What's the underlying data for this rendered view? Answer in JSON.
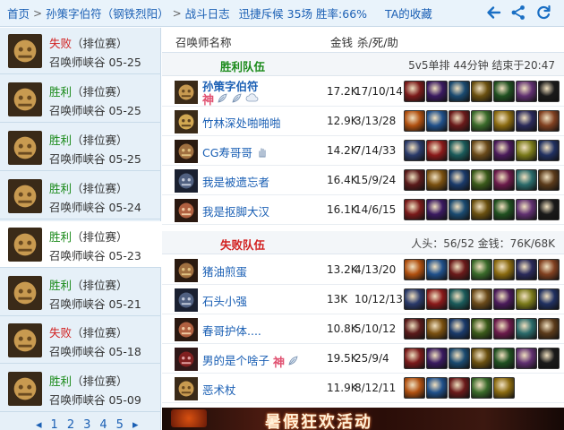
{
  "topbar": {
    "home": "首页",
    "sep": ">",
    "player": "孙策字伯符（钢铁烈阳）",
    "log": "战斗日志",
    "status": "迅捷斥候 35场 胜率:66%",
    "favorites": "TA的收藏"
  },
  "colors": {
    "win": "#1a8a1a",
    "lose": "#d22020",
    "link": "#1a5fb4",
    "sidebar_bg": "#e6f0f8"
  },
  "sidebar": {
    "matches": [
      {
        "result": "失败",
        "outcome": "lose",
        "type": "（排位赛）",
        "mode": "召唤师峡谷 05-25",
        "active": false
      },
      {
        "result": "胜利",
        "outcome": "win",
        "type": "（排位赛）",
        "mode": "召唤师峡谷 05-25",
        "active": false
      },
      {
        "result": "胜利",
        "outcome": "win",
        "type": "（排位赛）",
        "mode": "召唤师峡谷 05-25",
        "active": false
      },
      {
        "result": "胜利",
        "outcome": "win",
        "type": "（排位赛）",
        "mode": "召唤师峡谷 05-24",
        "active": false
      },
      {
        "result": "胜利",
        "outcome": "win",
        "type": "（排位赛）",
        "mode": "召唤师峡谷 05-23",
        "active": true
      },
      {
        "result": "胜利",
        "outcome": "win",
        "type": "（排位赛）",
        "mode": "召唤师峡谷 05-21",
        "active": false
      },
      {
        "result": "失败",
        "outcome": "lose",
        "type": "（排位赛）",
        "mode": "召唤师峡谷 05-18",
        "active": false
      },
      {
        "result": "胜利",
        "outcome": "win",
        "type": "（排位赛）",
        "mode": "召唤师峡谷 05-09",
        "active": false
      }
    ],
    "pager": {
      "prev": "◂",
      "pages": [
        "1",
        "2",
        "3",
        "4",
        "5"
      ],
      "next": "▸"
    }
  },
  "table": {
    "header": {
      "name": "召唤师名称",
      "gold": "金钱",
      "kda": "杀/死/助"
    },
    "win_team": {
      "label": "胜利队伍",
      "meta": "5v5单排 44分钟 结束于20:47",
      "players": [
        {
          "name": "孙策字伯符",
          "gold": "17.2K",
          "kda": "17/10/14",
          "badges": [
            "神",
            "feather",
            "feather",
            "cloud"
          ]
        },
        {
          "name": "竹林深处啪啪啪",
          "gold": "12.9K",
          "kda": "3/13/28",
          "badges": []
        },
        {
          "name": "CG寿哥哥",
          "gold": "14.2K",
          "kda": "7/14/33",
          "badges": [
            "hand"
          ]
        },
        {
          "name": "我是被遗忘者",
          "gold": "16.4K",
          "kda": "15/9/24",
          "badges": []
        },
        {
          "name": "我是抠脚大汉",
          "gold": "16.1K",
          "kda": "14/6/15",
          "badges": []
        }
      ]
    },
    "lose_team": {
      "label": "失败队伍",
      "meta": "人头：56/52 金钱：76K/68K",
      "players": [
        {
          "name": "猪油煎蛋",
          "gold": "13.2K",
          "kda": "4/13/20",
          "badges": []
        },
        {
          "name": "石头小强",
          "gold": "13K",
          "kda": "10/12/13",
          "badges": []
        },
        {
          "name": "春哥护体....",
          "gold": "10.8K",
          "kda": "5/10/12",
          "badges": []
        },
        {
          "name": "男的是个啥子",
          "gold": "19.5K",
          "kda": "25/9/4",
          "badges": [
            "神",
            "feather"
          ]
        },
        {
          "name": "恶术杖",
          "gold": "11.9K",
          "kda": "8/12/11",
          "badges": []
        }
      ]
    }
  },
  "banner": {
    "text": "暑假狂欢活动"
  }
}
